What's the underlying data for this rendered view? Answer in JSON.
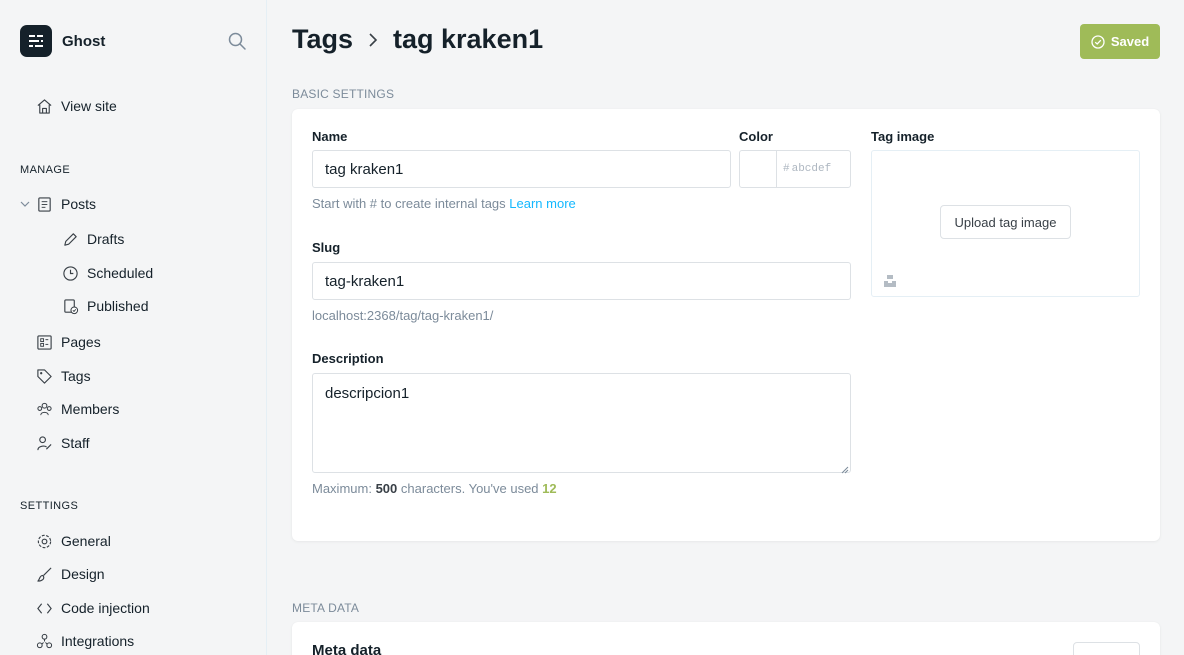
{
  "app": {
    "name": "Ghost"
  },
  "sidebar": {
    "view_site": "View site",
    "manage_label": "MANAGE",
    "manage_items": {
      "posts": "Posts",
      "drafts": "Drafts",
      "scheduled": "Scheduled",
      "published": "Published",
      "pages": "Pages",
      "tags": "Tags",
      "members": "Members",
      "staff": "Staff"
    },
    "settings_label": "SETTINGS",
    "settings_items": {
      "general": "General",
      "design": "Design",
      "code_injection": "Code injection",
      "integrations": "Integrations"
    }
  },
  "header": {
    "breadcrumb_parent": "Tags",
    "breadcrumb_current": "tag kraken1",
    "saved_label": "Saved"
  },
  "basic_settings": {
    "section_label": "BASIC SETTINGS",
    "name_label": "Name",
    "name_value": "tag kraken1",
    "name_help": "Start with # to create internal tags",
    "learn_more": "Learn more",
    "color_label": "Color",
    "color_placeholder": "abcdef",
    "tag_image_label": "Tag image",
    "upload_label": "Upload tag image",
    "slug_label": "Slug",
    "slug_value": "tag-kraken1",
    "slug_url": "localhost:2368/tag/tag-kraken1/",
    "description_label": "Description",
    "description_value": "descripcion1",
    "desc_help_prefix": "Maximum:",
    "desc_max": "500",
    "desc_help_mid": "characters. You've used",
    "desc_used": "12"
  },
  "meta": {
    "section_label": "META DATA",
    "title": "Meta data"
  },
  "colors": {
    "accent": "#14b8ff",
    "saved_green": "#9fbb58",
    "text_dark": "#15212a",
    "text_muted": "#7c8b9a"
  }
}
